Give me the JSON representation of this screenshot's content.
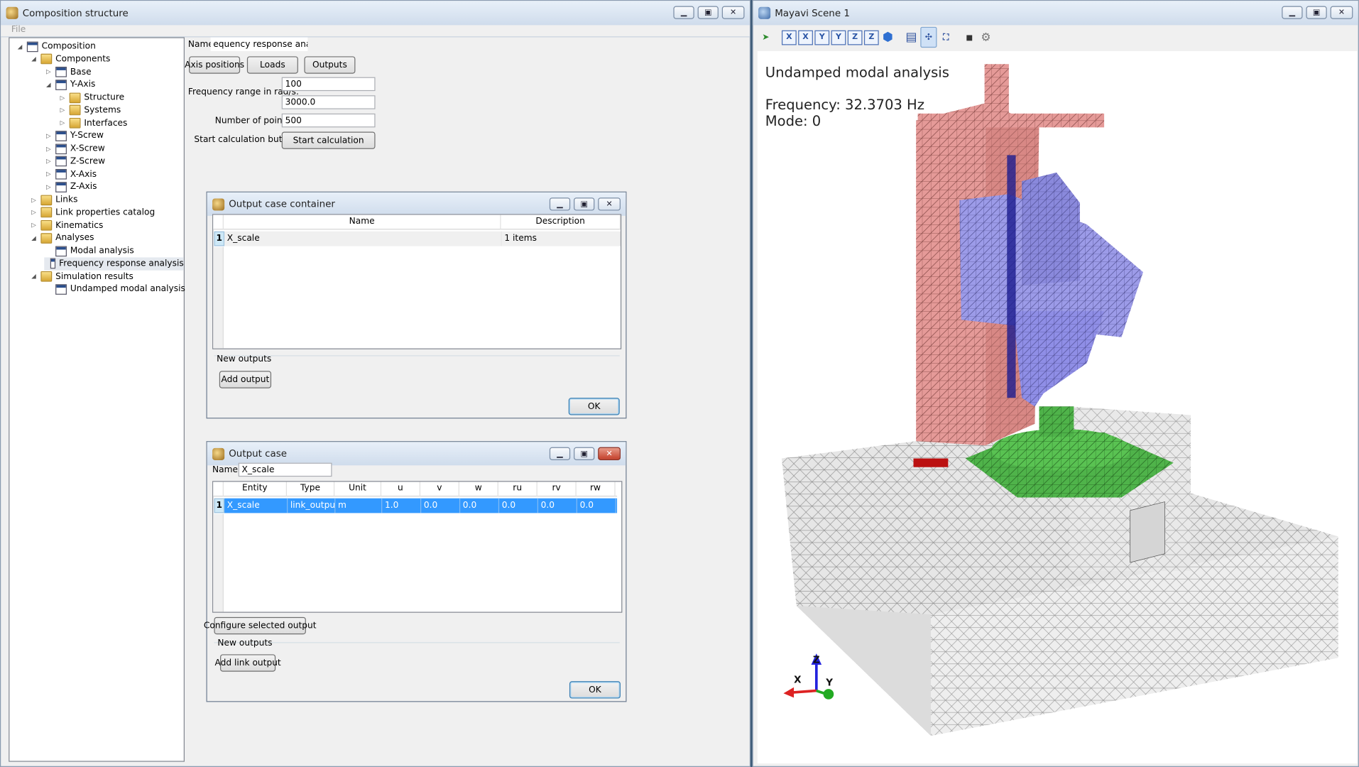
{
  "left_window": {
    "title": "Composition structure",
    "menu_file": "File",
    "tree": [
      {
        "label": "Composition",
        "level": 0,
        "expanded": true,
        "icon": "doc"
      },
      {
        "label": "Components",
        "level": 1,
        "expanded": true,
        "icon": "folder"
      },
      {
        "label": "Base",
        "level": 2,
        "expanded": false,
        "icon": "doc"
      },
      {
        "label": "Y-Axis",
        "level": 2,
        "expanded": true,
        "icon": "doc"
      },
      {
        "label": "Structure",
        "level": 3,
        "expanded": false,
        "icon": "folder"
      },
      {
        "label": "Systems",
        "level": 3,
        "expanded": false,
        "icon": "folder"
      },
      {
        "label": "Interfaces",
        "level": 3,
        "expanded": false,
        "icon": "folder"
      },
      {
        "label": "Y-Screw",
        "level": 2,
        "expanded": false,
        "icon": "doc"
      },
      {
        "label": "X-Screw",
        "level": 2,
        "expanded": false,
        "icon": "doc"
      },
      {
        "label": "Z-Screw",
        "level": 2,
        "expanded": false,
        "icon": "doc"
      },
      {
        "label": "X-Axis",
        "level": 2,
        "expanded": false,
        "icon": "doc"
      },
      {
        "label": "Z-Axis",
        "level": 2,
        "expanded": false,
        "icon": "doc"
      },
      {
        "label": "Links",
        "level": 1,
        "expanded": false,
        "icon": "folder"
      },
      {
        "label": "Link properties catalog",
        "level": 1,
        "expanded": false,
        "icon": "folder"
      },
      {
        "label": "Kinematics",
        "level": 1,
        "expanded": false,
        "icon": "folder"
      },
      {
        "label": "Analyses",
        "level": 1,
        "expanded": true,
        "icon": "folder"
      },
      {
        "label": "Modal analysis",
        "level": 2,
        "expanded": null,
        "icon": "doc"
      },
      {
        "label": "Frequency response analysis",
        "level": 2,
        "expanded": null,
        "icon": "doc",
        "selected": true
      },
      {
        "label": "Simulation results",
        "level": 1,
        "expanded": true,
        "icon": "folder"
      },
      {
        "label": "Undamped modal analysis",
        "level": 2,
        "expanded": null,
        "icon": "doc"
      }
    ],
    "form": {
      "name_label": "Name:",
      "name_value": "equency response analysis",
      "btn_axis_positions": "Axis positions",
      "btn_loads": "Loads",
      "btn_outputs": "Outputs",
      "freq_label": "Frequency range in rad/s:",
      "freq_min": "100",
      "freq_max": "3000.0",
      "points_label": "Number of points:",
      "points_value": "500",
      "start_label": "Start calculation button:",
      "start_button": "Start calculation"
    }
  },
  "dialog_container": {
    "title": "Output case container",
    "headers": [
      "Name",
      "Description"
    ],
    "rows": [
      {
        "num": "1",
        "name": "X_scale",
        "description": "1 items"
      }
    ],
    "group_label": "New outputs",
    "add_button": "Add output",
    "ok_button": "OK"
  },
  "dialog_case": {
    "title": "Output case",
    "name_label": "Name:",
    "name_value": "X_scale",
    "headers": [
      "Entity",
      "Type",
      "Unit",
      "u",
      "v",
      "w",
      "ru",
      "rv",
      "rw"
    ],
    "rows": [
      {
        "num": "1",
        "cells": [
          "X_scale",
          "link_output",
          "m",
          "1.0",
          "0.0",
          "0.0",
          "0.0",
          "0.0",
          "0.0"
        ]
      }
    ],
    "configure_button": "Configure selected output",
    "group_label": "New outputs",
    "add_link_button": "Add link output",
    "ok_button": "OK"
  },
  "mayavi": {
    "title": "Mayavi Scene 1",
    "toolbar": [
      "pipeline-icon",
      "x-plus",
      "x-minus",
      "y-plus",
      "y-minus",
      "z-plus",
      "z-minus",
      "iso-view",
      "parallel-projection",
      "axes-toggle",
      "fullscreen",
      "save",
      "configure"
    ],
    "toolbar_labels": {
      "x1": "X",
      "x2": "X",
      "y1": "Y",
      "y2": "Y",
      "z1": "Z",
      "z2": "Z"
    },
    "overlay_title": "Undamped modal analysis",
    "overlay_frequency": "Frequency: 32.3703 Hz",
    "overlay_mode": "Mode: 0",
    "axes": {
      "x": "X",
      "y": "Y",
      "z": "Z"
    }
  },
  "colors": {
    "column": "#e59a98",
    "spindle": "#8f8ee6",
    "table": "#4fb34a",
    "base": "#e6e6e6",
    "selection": "#3399ff"
  }
}
